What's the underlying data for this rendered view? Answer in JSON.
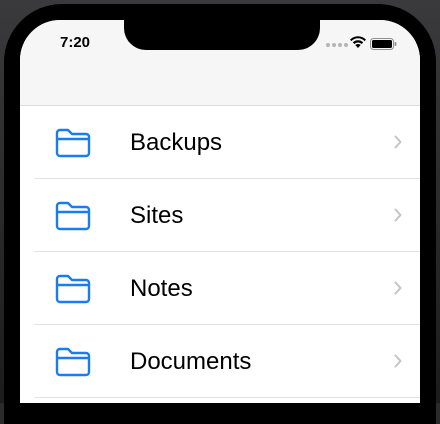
{
  "status_bar": {
    "time": "7:20",
    "icons": [
      "cellular-signal-icon",
      "wifi-icon",
      "battery-icon"
    ]
  },
  "colors": {
    "accent": "#1a7cf2",
    "chevron": "#c4c4c7",
    "separator": "#e3e3e6"
  },
  "folders": [
    {
      "label": "Backups",
      "icon": "folder-icon"
    },
    {
      "label": "Sites",
      "icon": "folder-icon"
    },
    {
      "label": "Notes",
      "icon": "folder-icon"
    },
    {
      "label": "Documents",
      "icon": "folder-icon"
    }
  ]
}
